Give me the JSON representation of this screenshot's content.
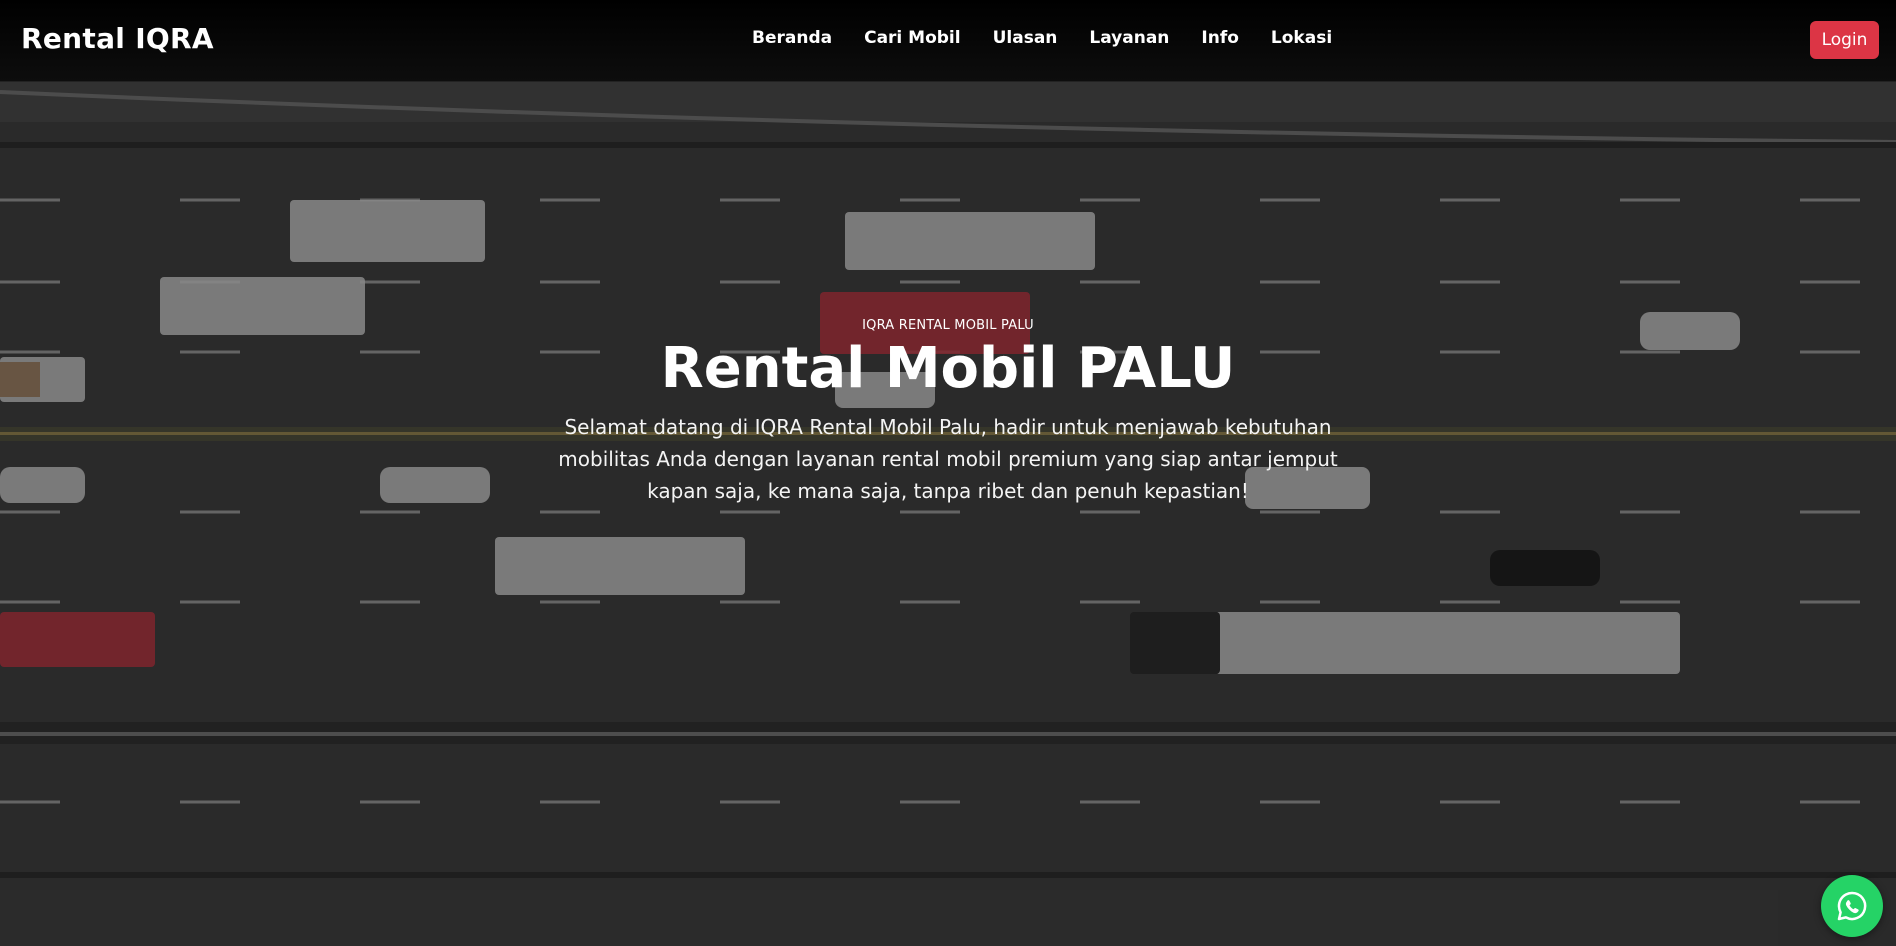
{
  "navbar": {
    "brand": "Rental IQRA",
    "links": [
      "Beranda",
      "Cari Mobil",
      "Ulasan",
      "Layanan",
      "Info",
      "Lokasi"
    ],
    "login_label": "Login"
  },
  "hero": {
    "eyebrow": "IQRA RENTAL MOBIL PALU",
    "title": "Rental Mobil PALU",
    "description": "Selamat datang di IQRA Rental Mobil Palu, hadir untuk menjawab kebutuhan mobilitas Anda dengan layanan rental mobil premium yang siap antar jemput kapan saja, ke mana saja, tanpa ribet dan penuh kepastian!",
    "background": "aerial-highway-photo"
  },
  "floating": {
    "whatsapp_icon": "whatsapp-icon"
  },
  "colors": {
    "accent": "#dc3545",
    "whatsapp": "#25d366",
    "navbar": "#000000"
  }
}
